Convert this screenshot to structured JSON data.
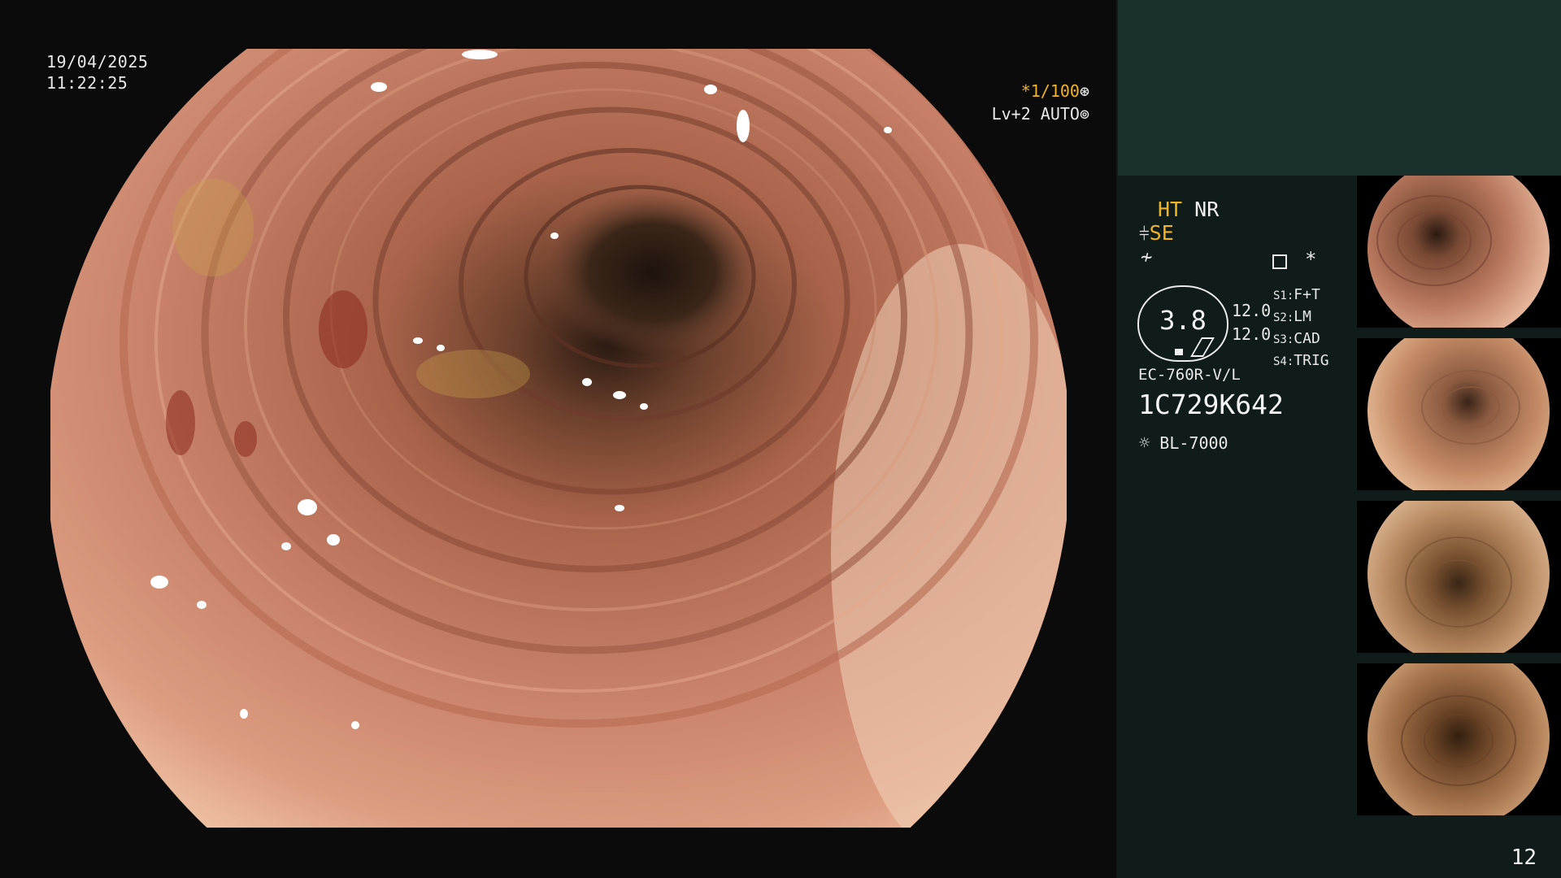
{
  "overlay": {
    "date": "19/04/2025",
    "time": "11:22:25",
    "zoom": "*1/100",
    "zoom_icon": "shutter-icon",
    "level": "Lv+2 AUTO",
    "level_icon": "iris-icon"
  },
  "panel": {
    "mode_ht": "HT",
    "mode_nr": "NR",
    "mode_se": "SE",
    "modifier_asterisk": "*",
    "focus_value": "3.8",
    "value_1": "12.0",
    "value_2": "12.0",
    "scope_switches": [
      {
        "key": "S1:",
        "value": "F+T"
      },
      {
        "key": "S2:",
        "value": "LM"
      },
      {
        "key": "S3:",
        "value": "CAD"
      },
      {
        "key": "S4:",
        "value": "TRIG"
      }
    ],
    "scope_model": "EC-760R-V/L",
    "serial": "1C729K642",
    "light_source": "BL-7000",
    "page_number": "12"
  },
  "colors": {
    "mucosa": "#c98063",
    "lumen": "#2b1c14",
    "panel_bg": "#0f1c19",
    "panel_header": "#1a302c",
    "accent_yellow": "#f0b429"
  }
}
